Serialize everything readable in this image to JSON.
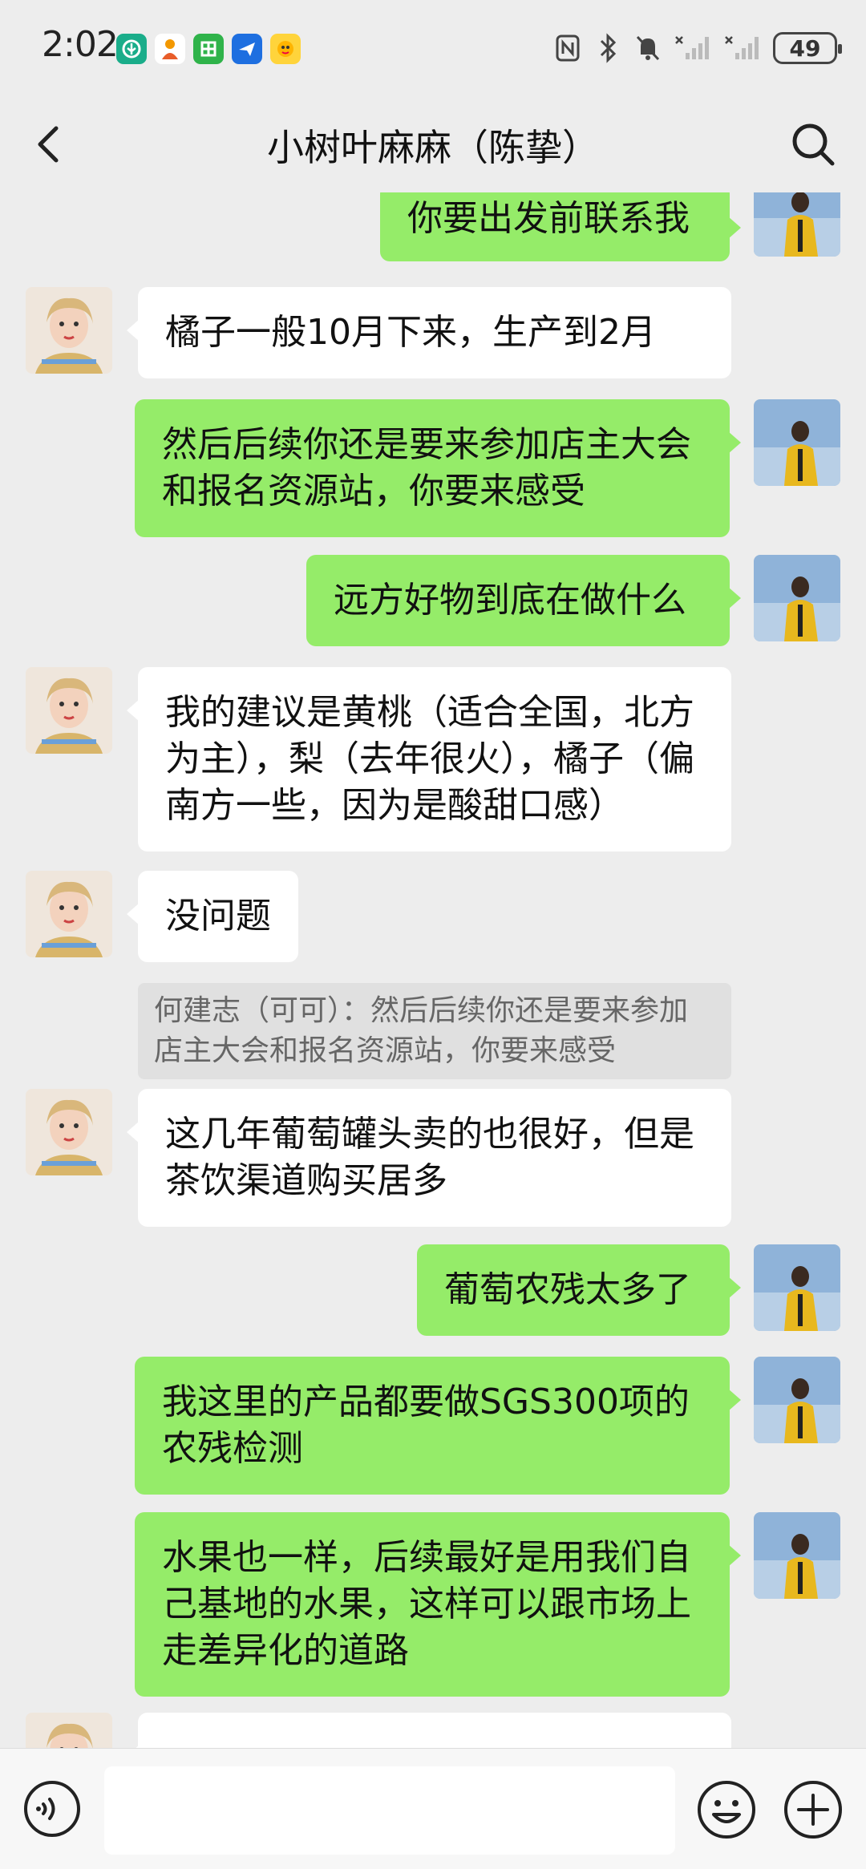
{
  "status": {
    "time": "2:02",
    "battery": "49"
  },
  "nav": {
    "title": "小树叶麻麻（陈挚）"
  },
  "messages": [
    {
      "side": "right",
      "text": "你要出发前联系我"
    },
    {
      "side": "left",
      "text": "橘子一般10月下来，生产到2月"
    },
    {
      "side": "right",
      "text": "然后后续你还是要来参加店主大会和报名资源站，你要来感受"
    },
    {
      "side": "right",
      "text": "远方好物到底在做什么"
    },
    {
      "side": "left",
      "text": "我的建议是黄桃（适合全国，北方为主），梨（去年很火），橘子（偏南方一些，因为是酸甜口感）"
    },
    {
      "side": "left",
      "text": "没问题"
    },
    {
      "side": "quote",
      "text": "何建志（可可）：然后后续你还是要来参加店主大会和报名资源站，你要来感受"
    },
    {
      "side": "left",
      "text": "这几年葡萄罐头卖的也很好，但是茶饮渠道购买居多"
    },
    {
      "side": "right",
      "text": "葡萄农残太多了"
    },
    {
      "side": "right",
      "text": "我这里的产品都要做SGS300项的农残检测"
    },
    {
      "side": "right",
      "text": "水果也一样，后续最好是用我们自己基地的水果，这样可以跟市场上走差异化的道路"
    },
    {
      "side": "left",
      "text": ""
    }
  ],
  "input": {
    "placeholder": ""
  },
  "colors": {
    "background": "#ededed",
    "green_bubble": "#95ec69",
    "white_bubble": "#ffffff"
  }
}
